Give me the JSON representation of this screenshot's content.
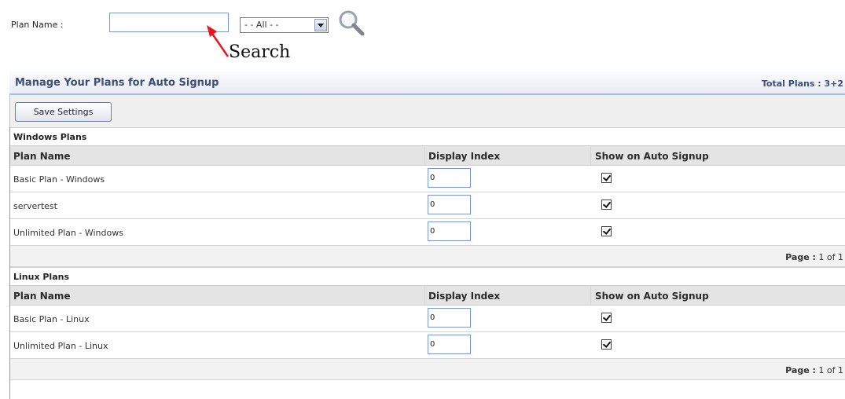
{
  "search": {
    "label": "Plan Name :",
    "input_value": "",
    "filter_selected": "- - All - -",
    "icon": "magnifier-icon"
  },
  "annotation": {
    "label": "Search",
    "arrow_color": "#e8161c"
  },
  "panel": {
    "title": "Manage Your Plans for Auto Signup",
    "total_label": "Total Plans : 3+2",
    "save_label": "Save Settings"
  },
  "columns": {
    "plan": "Plan Name",
    "index": "Display Index",
    "show": "Show on Auto Signup"
  },
  "sections": [
    {
      "title": "Windows Plans",
      "rows": [
        {
          "name": "Basic Plan - Windows",
          "index": "0",
          "show": true
        },
        {
          "name": "servertest",
          "index": "0",
          "show": true
        },
        {
          "name": "Unlimited Plan - Windows",
          "index": "0",
          "show": true
        }
      ],
      "pager": {
        "label": "Page :",
        "value": "1 of 1"
      }
    },
    {
      "title": "Linux Plans",
      "rows": [
        {
          "name": "Basic Plan - Linux",
          "index": "0",
          "show": true
        },
        {
          "name": "Unlimited Plan - Linux",
          "index": "0",
          "show": true
        }
      ],
      "pager": {
        "label": "Page :",
        "value": "1 of 1"
      }
    }
  ],
  "colors": {
    "header_text": "#3c4f74",
    "input_border": "#7a98cf",
    "header_rule": "#a9bde0"
  }
}
